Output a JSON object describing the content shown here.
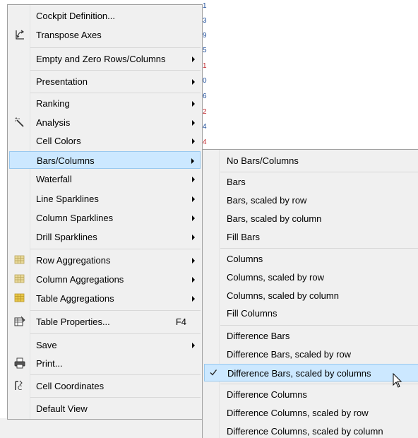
{
  "main_menu": {
    "items": [
      {
        "label": "Cockpit Definition...",
        "arrow": false,
        "icon": ""
      },
      {
        "label": "Transpose Axes",
        "arrow": false,
        "icon": "transpose-icon"
      },
      {
        "label": "Empty and Zero Rows/Columns",
        "arrow": true,
        "icon": ""
      },
      {
        "label": "Presentation",
        "arrow": true,
        "icon": ""
      },
      {
        "label": "Ranking",
        "arrow": true,
        "icon": ""
      },
      {
        "label": "Analysis",
        "arrow": true,
        "icon": "magic-wand-icon"
      },
      {
        "label": "Cell Colors",
        "arrow": true,
        "icon": ""
      },
      {
        "label": "Bars/Columns",
        "arrow": true,
        "icon": "",
        "highlighted": true
      },
      {
        "label": "Waterfall",
        "arrow": true,
        "icon": ""
      },
      {
        "label": "Line Sparklines",
        "arrow": true,
        "icon": ""
      },
      {
        "label": "Column Sparklines",
        "arrow": true,
        "icon": ""
      },
      {
        "label": "Drill Sparklines",
        "arrow": true,
        "icon": ""
      },
      {
        "label": "Row Aggregations",
        "arrow": true,
        "icon": "grid-icon"
      },
      {
        "label": "Column Aggregations",
        "arrow": true,
        "icon": "grid-icon"
      },
      {
        "label": "Table Aggregations",
        "arrow": true,
        "icon": "grid-icon"
      },
      {
        "label": "Table Properties...",
        "arrow": false,
        "icon": "table-properties-icon",
        "shortcut": "F4"
      },
      {
        "label": "Save",
        "arrow": true,
        "icon": ""
      },
      {
        "label": "Print...",
        "arrow": false,
        "icon": "printer-icon"
      },
      {
        "label": "Cell Coordinates",
        "arrow": false,
        "icon": "cell-coordinates-icon"
      },
      {
        "label": "Default View",
        "arrow": false,
        "icon": ""
      }
    ]
  },
  "sub_menu": {
    "items": [
      {
        "label": "No Bars/Columns"
      },
      {
        "label": "Bars"
      },
      {
        "label": "Bars, scaled by row"
      },
      {
        "label": "Bars, scaled by column"
      },
      {
        "label": "Fill Bars"
      },
      {
        "label": "Columns"
      },
      {
        "label": "Columns, scaled by row"
      },
      {
        "label": "Columns, scaled by column"
      },
      {
        "label": "Fill Columns"
      },
      {
        "label": "Difference Bars"
      },
      {
        "label": "Difference Bars, scaled by row"
      },
      {
        "label": "Difference Bars, scaled by columns",
        "checked": true,
        "highlighted": true
      },
      {
        "label": "Difference Columns"
      },
      {
        "label": "Difference Columns, scaled by row"
      },
      {
        "label": "Difference Columns, scaled by column"
      }
    ]
  },
  "background_digits": [
    {
      "text": "1",
      "color": "#1f4e9a"
    },
    {
      "text": "3",
      "color": "#1f4e9a"
    },
    {
      "text": "9",
      "color": "#1f4e9a"
    },
    {
      "text": "5",
      "color": "#1f4e9a"
    },
    {
      "text": "1",
      "color": "#c0282d"
    },
    {
      "text": "0",
      "color": "#1f4e9a"
    },
    {
      "text": "6",
      "color": "#1f4e9a"
    },
    {
      "text": "2",
      "color": "#c0282d"
    },
    {
      "text": "4",
      "color": "#1f4e9a"
    },
    {
      "text": "4",
      "color": "#c0282d"
    }
  ],
  "colors": {
    "menu_bg": "#f0f0f0",
    "highlight_bg": "#cce8ff",
    "highlight_border": "#99c9ef",
    "separator": "#d8d8d8"
  }
}
